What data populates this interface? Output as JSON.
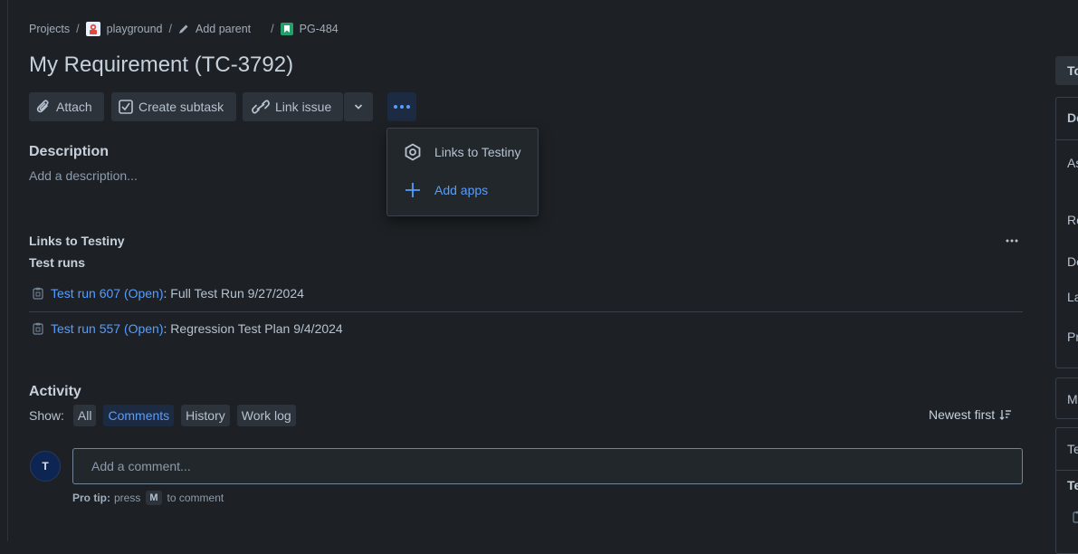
{
  "breadcrumb": {
    "projects": "Projects",
    "project": "playground",
    "add_parent": "Add parent",
    "issue_key": "PG-484"
  },
  "title": "My Requirement (TC-3792)",
  "toolbar": {
    "attach": "Attach",
    "create_subtask": "Create subtask",
    "link_issue": "Link issue"
  },
  "more_menu": {
    "items": [
      {
        "label": "Links to Testiny",
        "icon": "hexagon-icon"
      },
      {
        "label": "Add apps",
        "icon": "plus-icon"
      }
    ]
  },
  "description": {
    "heading": "Description",
    "placeholder": "Add a description..."
  },
  "testiny": {
    "heading": "Links to Testiny",
    "subheading": "Test runs",
    "runs": [
      {
        "link": "Test run 607 (Open)",
        "text": ": Full Test Run 9/27/2024"
      },
      {
        "link": "Test run 557 (Open)",
        "text": ": Regression Test Plan 9/4/2024"
      }
    ]
  },
  "activity": {
    "heading": "Activity",
    "show_label": "Show:",
    "filters": [
      "All",
      "Comments",
      "History",
      "Work log"
    ],
    "active_filter": "Comments",
    "sort": "Newest first",
    "avatar_initial": "T",
    "comment_placeholder": "Add a comment...",
    "tip_bold": "Pro tip:",
    "tip_press": "press",
    "tip_key": "M",
    "tip_rest": "to comment"
  },
  "right_panel": {
    "top": "To",
    "details_header": "De",
    "fields": [
      "As",
      "Re",
      "De",
      "La",
      "Pr"
    ],
    "more": "M",
    "testiny_header": "Te",
    "testiny_sub": "Te"
  },
  "colors": {
    "background": "#1d2125",
    "link": "#579dff",
    "active_filter_bg": "#1c2b41",
    "project_badge": "#22a06b"
  }
}
